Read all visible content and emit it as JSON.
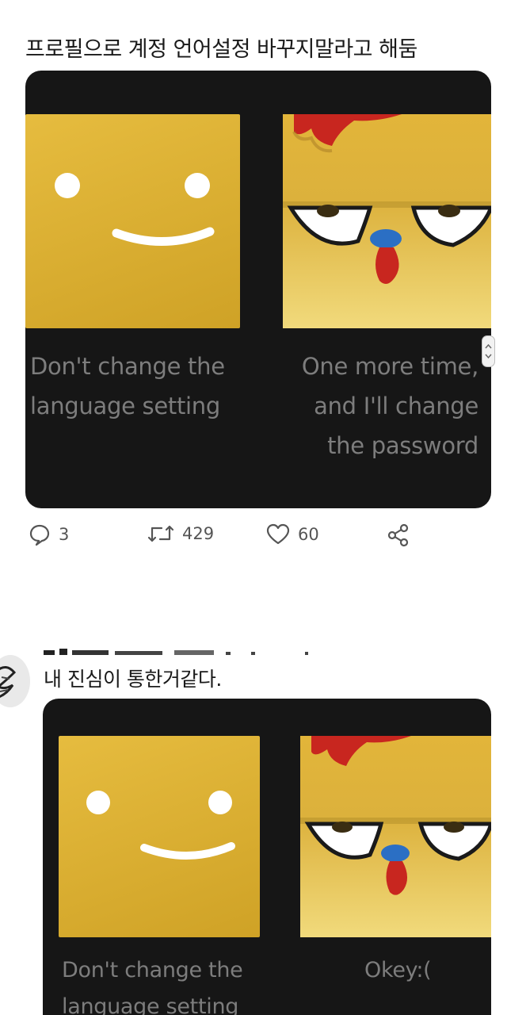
{
  "post1": {
    "text": "프로필으로 계정 언어설정 바꾸지말라고 해둠",
    "card": {
      "left_caption_lines": [
        "Don't change the",
        "language setting"
      ],
      "right_caption_lines": [
        "One more time,",
        "and I'll change",
        "the password"
      ]
    },
    "actions": {
      "reply_count": "3",
      "retweet_count": "429",
      "like_count": "60",
      "reply_icon": "speech-bubble-icon",
      "retweet_icon": "retweet-icon",
      "like_icon": "heart-icon",
      "share_icon": "share-icon"
    }
  },
  "post2": {
    "text": "내 진심이 통한거같다.",
    "card": {
      "left_caption_lines": [
        "Don't change the",
        "language setting"
      ],
      "right_caption_lines": [
        "Okey:("
      ]
    }
  },
  "colors": {
    "card_bg": "#161616",
    "avatar_yellow": "#dcb13c",
    "caption_gray": "#7d7d7d",
    "comb_red": "#c8261f",
    "beak_blue": "#2b6fc4"
  }
}
